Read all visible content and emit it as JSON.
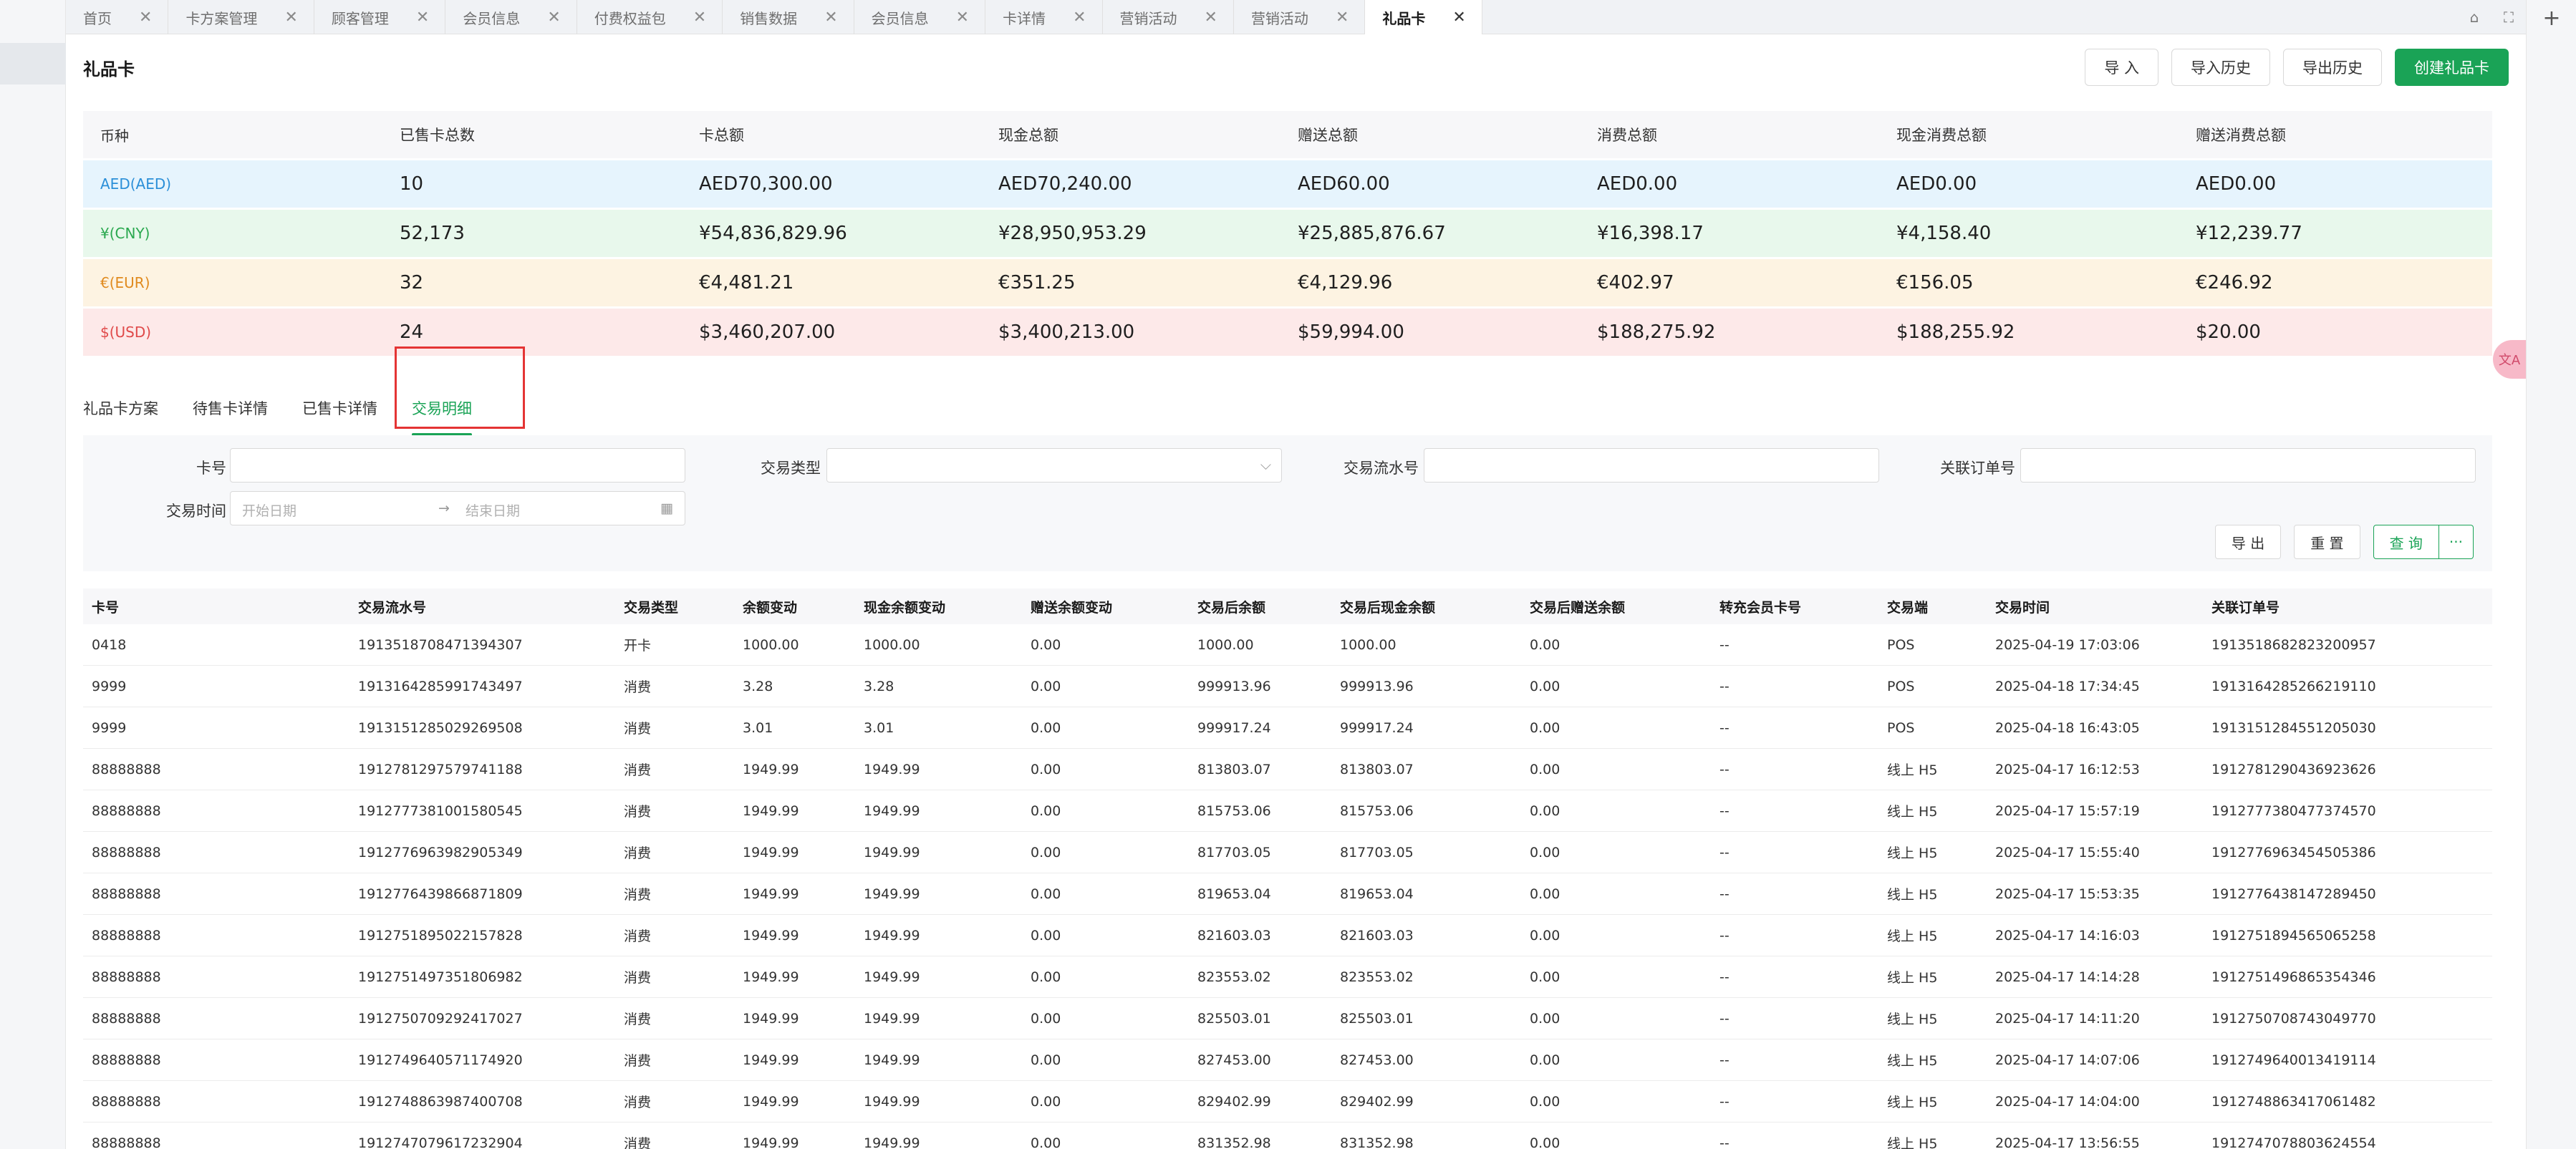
{
  "tabs": [
    {
      "label": "首页",
      "active": false
    },
    {
      "label": "卡方案管理",
      "active": false
    },
    {
      "label": "顾客管理",
      "active": false
    },
    {
      "label": "会员信息",
      "active": false
    },
    {
      "label": "付费权益包",
      "active": false
    },
    {
      "label": "销售数据",
      "active": false
    },
    {
      "label": "会员信息",
      "active": false
    },
    {
      "label": "卡详情",
      "active": false
    },
    {
      "label": "营销活动",
      "active": false
    },
    {
      "label": "营销活动",
      "active": false
    },
    {
      "label": "礼品卡",
      "active": true
    }
  ],
  "tab_close": "✕",
  "tabbar_icons": {
    "home": "⌂",
    "fullscreen": "⛶",
    "plus": "+"
  },
  "page": {
    "title": "礼品卡"
  },
  "header_buttons": {
    "import": "导 入",
    "import_history": "导入历史",
    "export_history": "导出历史",
    "create": "创建礼品卡"
  },
  "summary": {
    "headers": [
      "币种",
      "已售卡总数",
      "卡总额",
      "现金总额",
      "赠送总额",
      "消费总额",
      "现金消费总额",
      "赠送消费总额"
    ],
    "rows": [
      {
        "currency": "AED(AED)",
        "sold": "10",
        "total": "AED70,300.00",
        "cash": "AED70,240.00",
        "gift": "AED60.00",
        "consume": "AED0.00",
        "cash_consume": "AED0.00",
        "gift_consume": "AED0.00"
      },
      {
        "currency": "¥(CNY)",
        "sold": "52,173",
        "total": "¥54,836,829.96",
        "cash": "¥28,950,953.29",
        "gift": "¥25,885,876.67",
        "consume": "¥16,398.17",
        "cash_consume": "¥4,158.40",
        "gift_consume": "¥12,239.77"
      },
      {
        "currency": "€(EUR)",
        "sold": "32",
        "total": "€4,481.21",
        "cash": "€351.25",
        "gift": "€4,129.96",
        "consume": "€402.97",
        "cash_consume": "€156.05",
        "gift_consume": "€246.92"
      },
      {
        "currency": "$(USD)",
        "sold": "24",
        "total": "$3,460,207.00",
        "cash": "$3,400,213.00",
        "gift": "$59,994.00",
        "consume": "$188,275.92",
        "cash_consume": "$188,255.92",
        "gift_consume": "$20.00"
      }
    ]
  },
  "subtabs": [
    {
      "label": "礼品卡方案",
      "active": false
    },
    {
      "label": "待售卡详情",
      "active": false
    },
    {
      "label": "已售卡详情",
      "active": false
    },
    {
      "label": "交易明细",
      "active": true
    }
  ],
  "filters": {
    "card_no_label": "卡号",
    "txn_type_label": "交易类型",
    "txn_serial_label": "交易流水号",
    "order_no_label": "关联订单号",
    "txn_time_label": "交易时间",
    "start_placeholder": "开始日期",
    "end_placeholder": "结束日期",
    "range_sep": "→",
    "select_arrow": "⌵",
    "calendar_icon": "▦"
  },
  "filter_buttons": {
    "export": "导 出",
    "reset": "重 置",
    "query": "查 询",
    "more": "···"
  },
  "table": {
    "headers": [
      "卡号",
      "交易流水号",
      "交易类型",
      "余额变动",
      "现金余额变动",
      "赠送余额变动",
      "交易后余额",
      "交易后现金余额",
      "交易后赠送余额",
      "转充会员卡号",
      "交易端",
      "交易时间",
      "关联订单号"
    ],
    "rows": [
      [
        "0418",
        "1913518708471394307",
        "开卡",
        "1000.00",
        "1000.00",
        "0.00",
        "1000.00",
        "1000.00",
        "0.00",
        "--",
        "POS",
        "2025-04-19 17:03:06",
        "1913518682823200957"
      ],
      [
        "9999",
        "1913164285991743497",
        "消费",
        "3.28",
        "3.28",
        "0.00",
        "999913.96",
        "999913.96",
        "0.00",
        "--",
        "POS",
        "2025-04-18 17:34:45",
        "1913164285266219110"
      ],
      [
        "9999",
        "1913151285029269508",
        "消费",
        "3.01",
        "3.01",
        "0.00",
        "999917.24",
        "999917.24",
        "0.00",
        "--",
        "POS",
        "2025-04-18 16:43:05",
        "1913151284551205030"
      ],
      [
        "88888888",
        "1912781297579741188",
        "消费",
        "1949.99",
        "1949.99",
        "0.00",
        "813803.07",
        "813803.07",
        "0.00",
        "--",
        "线上 H5",
        "2025-04-17 16:12:53",
        "1912781290436923626"
      ],
      [
        "88888888",
        "1912777381001580545",
        "消费",
        "1949.99",
        "1949.99",
        "0.00",
        "815753.06",
        "815753.06",
        "0.00",
        "--",
        "线上 H5",
        "2025-04-17 15:57:19",
        "1912777380477374570"
      ],
      [
        "88888888",
        "1912776963982905349",
        "消费",
        "1949.99",
        "1949.99",
        "0.00",
        "817703.05",
        "817703.05",
        "0.00",
        "--",
        "线上 H5",
        "2025-04-17 15:55:40",
        "1912776963454505386"
      ],
      [
        "88888888",
        "1912776439866871809",
        "消费",
        "1949.99",
        "1949.99",
        "0.00",
        "819653.04",
        "819653.04",
        "0.00",
        "--",
        "线上 H5",
        "2025-04-17 15:53:35",
        "1912776438147289450"
      ],
      [
        "88888888",
        "1912751895022157828",
        "消费",
        "1949.99",
        "1949.99",
        "0.00",
        "821603.03",
        "821603.03",
        "0.00",
        "--",
        "线上 H5",
        "2025-04-17 14:16:03",
        "1912751894565065258"
      ],
      [
        "88888888",
        "1912751497351806982",
        "消费",
        "1949.99",
        "1949.99",
        "0.00",
        "823553.02",
        "823553.02",
        "0.00",
        "--",
        "线上 H5",
        "2025-04-17 14:14:28",
        "1912751496865354346"
      ],
      [
        "88888888",
        "1912750709292417027",
        "消费",
        "1949.99",
        "1949.99",
        "0.00",
        "825503.01",
        "825503.01",
        "0.00",
        "--",
        "线上 H5",
        "2025-04-17 14:11:20",
        "1912750708743049770"
      ],
      [
        "88888888",
        "1912749640571174920",
        "消费",
        "1949.99",
        "1949.99",
        "0.00",
        "827453.00",
        "827453.00",
        "0.00",
        "--",
        "线上 H5",
        "2025-04-17 14:07:06",
        "1912749640013419114"
      ],
      [
        "88888888",
        "1912748863987400708",
        "消费",
        "1949.99",
        "1949.99",
        "0.00",
        "829402.99",
        "829402.99",
        "0.00",
        "--",
        "线上 H5",
        "2025-04-17 14:04:00",
        "1912748863417061482"
      ],
      [
        "88888888",
        "1912747079617232904",
        "消费",
        "1949.99",
        "1949.99",
        "0.00",
        "831352.98",
        "831352.98",
        "0.00",
        "--",
        "线上 H5",
        "2025-04-17 13:56:55",
        "1912747078803624554"
      ]
    ]
  },
  "float_widget": "文A"
}
